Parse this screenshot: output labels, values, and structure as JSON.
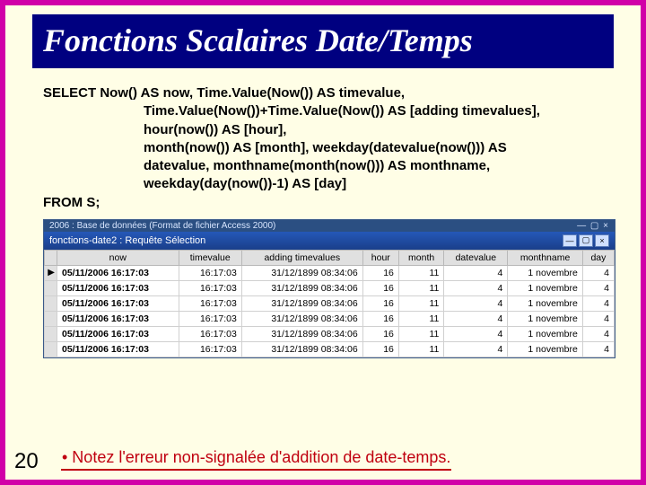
{
  "title": "Fonctions Scalaires Date/Temps",
  "page_number": "20",
  "note_text": "• Notez l'erreur non-signalée d'addition de date-temps.",
  "sql": {
    "line1": "SELECT Now() AS now, Time.Value(Now()) AS timevalue,",
    "line2": "Time.Value(Now())+Time.Value(Now()) AS [adding timevalues],",
    "line3": "hour(now()) AS [hour],",
    "line4": "month(now()) AS [month], weekday(datevalue(now())) AS",
    "line5": "datevalue, monthname(month(now())) AS monthname,",
    "line6": "weekday(day(now())-1) AS [day]",
    "line7": "FROM S;"
  },
  "db_window": {
    "db_title": "2006 : Base de données (Format de fichier Access 2000)",
    "query_title": "fonctions-date2 : Requête Sélection",
    "columns": [
      "",
      "now",
      "timevalue",
      "adding timevalues",
      "hour",
      "month",
      "datevalue",
      "monthname",
      "day"
    ],
    "row": {
      "now": "05/11/2006 16:17:03",
      "timevalue": "16:17:03",
      "adding": "31/12/1899 08:34:06",
      "hour": "16",
      "month": "11",
      "datevalue": "4",
      "monthname": "1 novembre",
      "day": "4"
    },
    "row_count": 6
  }
}
